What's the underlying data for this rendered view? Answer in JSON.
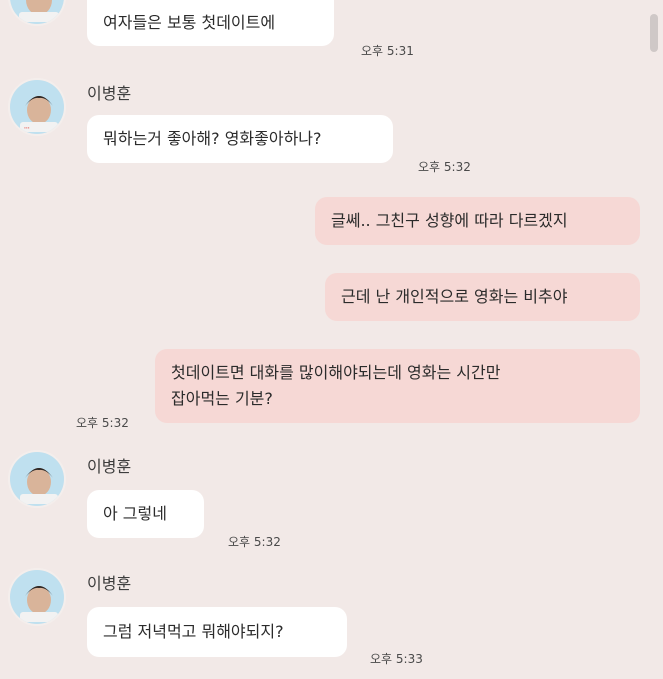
{
  "colors": {
    "background": "#f2e9e7",
    "incoming_bubble": "#ffffff",
    "outgoing_bubble": "#f6d8d5"
  },
  "messages": [
    {
      "sender": "",
      "text": "여자들은 보통 첫데이트에",
      "time": "오후 5:31"
    },
    {
      "sender": "이병훈",
      "text": "뭐하는거 좋아해? 영화좋아하나?",
      "time": "오후 5:32"
    },
    {
      "sender": "",
      "text": "글쎄.. 그친구 성향에 따라 다르겠지",
      "time": ""
    },
    {
      "sender": "",
      "text": "근데 난 개인적으로 영화는 비추야",
      "time": ""
    },
    {
      "sender": "",
      "text": "첫데이트면 대화를 많이해야되는데 영화는 시간만",
      "text2": "잡아먹는 기분?",
      "time": "오후 5:32"
    },
    {
      "sender": "이병훈",
      "text": "아 그렇네",
      "time": "오후 5:32"
    },
    {
      "sender": "이병훈",
      "text": "그럼 저녁먹고 뭐해야되지?",
      "time": "오후 5:33"
    }
  ]
}
